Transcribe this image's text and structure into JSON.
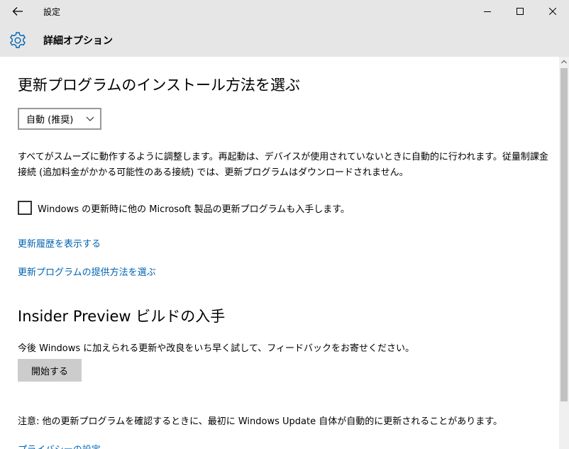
{
  "window": {
    "title": "設定",
    "controls": {
      "back": "arrow-left-icon",
      "minimize": "minimize-icon",
      "maximize": "maximize-icon",
      "close": "close-icon"
    }
  },
  "header": {
    "icon": "gear-icon",
    "title": "詳細オプション"
  },
  "install_section": {
    "title": "更新プログラムのインストール方法を選ぶ",
    "dropdown_selected": "自動 (推奨)",
    "description": "すべてがスムーズに動作するように調整します。再起動は、デバイスが使用されていないときに自動的に行われます。従量制課金接続 (追加料金がかかる可能性のある接続) では、更新プログラムはダウンロードされません。",
    "checkbox_label": "Windows の更新時に他の Microsoft 製品の更新プログラムも入手します。",
    "checkbox_checked": false,
    "links": {
      "history": "更新履歴を表示する",
      "delivery": "更新プログラムの提供方法を選ぶ"
    }
  },
  "insider_section": {
    "title": "Insider Preview ビルドの入手",
    "description": "今後 Windows に加えられる更新や改良をいち早く試して、フィードバックをお寄せください。",
    "button": "開始する"
  },
  "note": "注意: 他の更新プログラムを確認するときに、最初に Windows Update 自体が自動的に更新されることがあります。",
  "partial_link": "プライバシーの設定",
  "colors": {
    "titlebar_bg": "#e6e6e6",
    "link": "#0063b1",
    "accent_icon": "#0063b1",
    "button_bg": "#cccccc"
  }
}
